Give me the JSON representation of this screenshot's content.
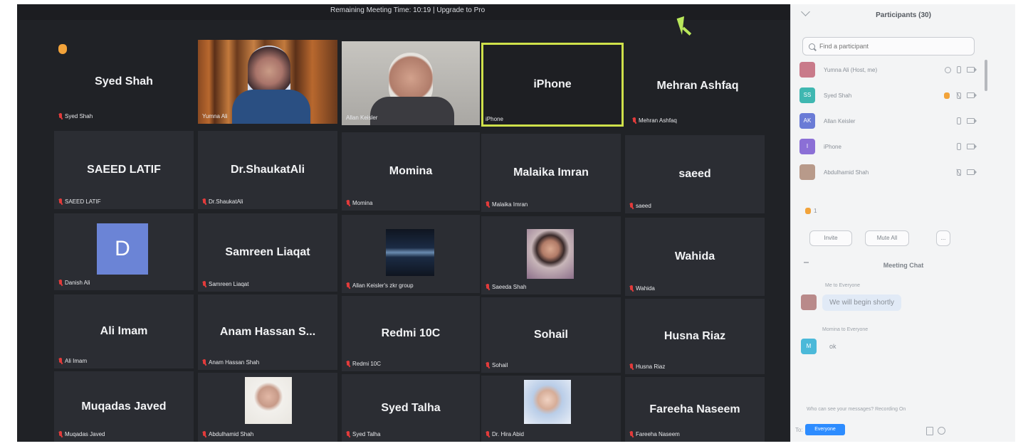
{
  "header": {
    "meeting_timer": "Remaining Meeting Time: 10:19 | Upgrade to Pro"
  },
  "gallery": {
    "tiles": [
      {
        "name": "Syed Shah",
        "label": "Syed Shah"
      },
      {
        "label": "Yumna Ali"
      },
      {
        "label": "Allan Keisler"
      },
      {
        "name": "iPhone",
        "label": "iPhone"
      },
      {
        "name": "Mehran Ashfaq",
        "label": "Mehran Ashfaq"
      },
      {
        "name": "SAEED LATIF",
        "label": "SAEED LATIF"
      },
      {
        "name": "Dr.ShaukatAli",
        "label": "Dr.ShaukatAli"
      },
      {
        "name": "Momina",
        "label": "Momina"
      },
      {
        "name": "Malaika Imran",
        "label": "Malaika Imran"
      },
      {
        "name": "saeed",
        "label": "saeed"
      },
      {
        "avatar_letter": "D",
        "label": "Danish Ali"
      },
      {
        "name": "Samreen Liaqat",
        "label": "Samreen Liaqat"
      },
      {
        "label": "Allan Keisler's zkr group"
      },
      {
        "label": "Saeeda Shah"
      },
      {
        "name": "Wahida",
        "label": "Wahida"
      },
      {
        "name": "Ali Imam",
        "label": "Ali Imam"
      },
      {
        "name": "Anam Hassan S...",
        "label": "Anam Hassan Shah"
      },
      {
        "name": "Redmi 10C",
        "label": "Redmi 10C"
      },
      {
        "name": "Sohail",
        "label": "Sohail"
      },
      {
        "name": "Husna Riaz",
        "label": "Husna Riaz"
      },
      {
        "name": "Muqadas Javed",
        "label": "Muqadas Javed"
      },
      {
        "label": "Abdulhamid Shah"
      },
      {
        "name": "Syed Talha",
        "label": "Syed Talha"
      },
      {
        "label": "Dr. Hira Abid"
      },
      {
        "name": "Fareeha Naseem",
        "label": "Fareeha Naseem"
      }
    ]
  },
  "sidebar": {
    "participants_title": "Participants (30)",
    "search_placeholder": "Find a participant",
    "participants": [
      {
        "initials": "",
        "name": "Yumna Ali (Host, me)",
        "color": "#c97a8a"
      },
      {
        "initials": "SS",
        "name": "Syed Shah",
        "color": "#3fb7b1"
      },
      {
        "initials": "AK",
        "name": "Allan Keisler",
        "color": "#6a7bd6"
      },
      {
        "initials": "I",
        "name": "iPhone",
        "color": "#8b6fd6"
      },
      {
        "initials": "",
        "name": "Abdulhamid Shah",
        "color": "#b89a8a"
      }
    ],
    "raised_hands_count": "1",
    "invite_label": "Invite",
    "mute_all_label": "Mute All",
    "more_label": "...",
    "chat_title": "Meeting Chat",
    "chat": [
      {
        "meta": "Me to Everyone",
        "text": "We will begin shortly"
      },
      {
        "meta": "Momina to Everyone",
        "text": "ok",
        "initials": "M"
      }
    ],
    "chat_footer": "Who can see your messages? Recording On",
    "to_label": "To:",
    "to_value": "Everyone"
  }
}
